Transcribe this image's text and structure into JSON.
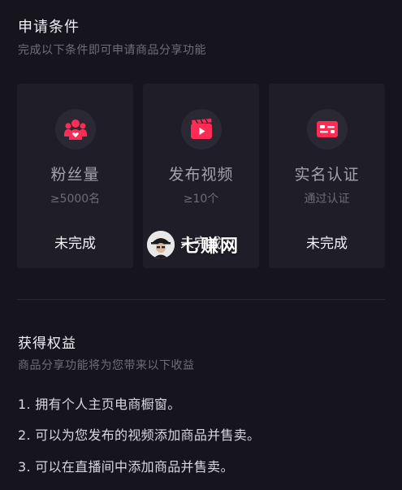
{
  "requirements": {
    "title": "申请条件",
    "subtitle": "完成以下条件即可申请商品分享功能",
    "cards": [
      {
        "icon": "fans-icon",
        "name": "粉丝量",
        "requirement": "≥5000名",
        "status": "未完成"
      },
      {
        "icon": "video-icon",
        "name": "发布视频",
        "requirement": "≥10个",
        "status": "未完成"
      },
      {
        "icon": "id-card-icon",
        "name": "实名认证",
        "requirement": "通过认证",
        "status": "未完成"
      }
    ]
  },
  "benefits": {
    "title": "获得权益",
    "subtitle": "商品分享功能将为您带来以下收益",
    "items": [
      "1. 拥有个人主页电商橱窗。",
      "2. 可以为您发布的视频添加商品并售卖。",
      "3. 可以在直播间中添加商品并售卖。"
    ]
  },
  "watermark": {
    "text": "七赚网"
  },
  "colors": {
    "background": "#16151d",
    "card": "#1f1e28",
    "accent": "#fe2c55"
  }
}
